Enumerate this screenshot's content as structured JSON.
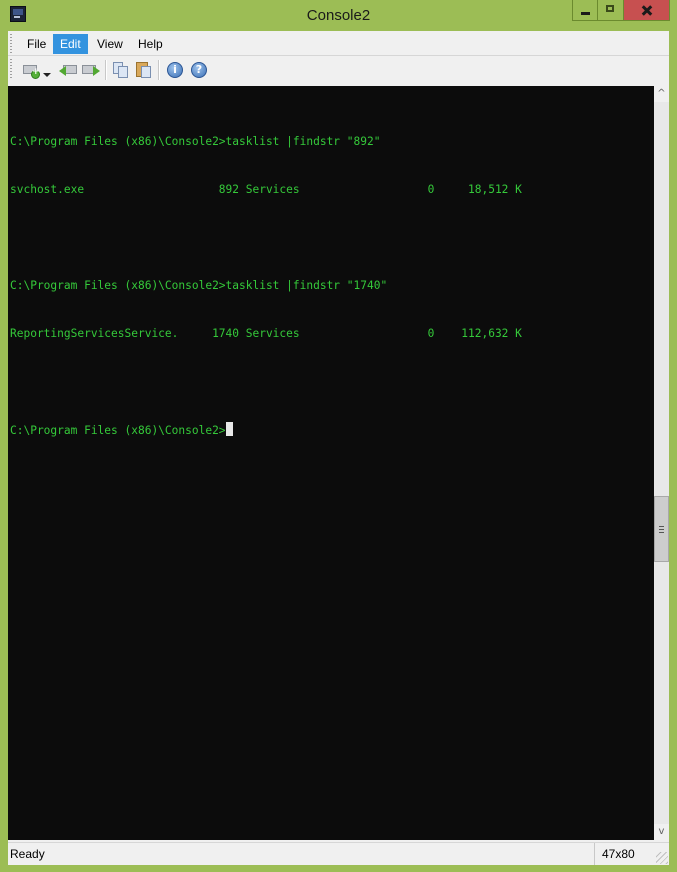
{
  "window": {
    "title": "Console2",
    "icon": "console-app-icon",
    "controls": [
      "minimize",
      "maximize",
      "close"
    ]
  },
  "menu": {
    "items": [
      {
        "label": "File",
        "active": false
      },
      {
        "label": "Edit",
        "active": true
      },
      {
        "label": "View",
        "active": false
      },
      {
        "label": "Help",
        "active": false
      }
    ]
  },
  "toolbar": {
    "buttons": [
      {
        "name": "new-tab",
        "icon": "new-console-icon"
      },
      {
        "name": "new-tab-dropdown",
        "icon": "dropdown-arrow-icon"
      },
      {
        "name": "previous-tab",
        "icon": "arrow-left-icon"
      },
      {
        "name": "next-tab",
        "icon": "arrow-right-icon"
      },
      {
        "name": "copy",
        "icon": "copy-icon"
      },
      {
        "name": "paste",
        "icon": "paste-icon"
      },
      {
        "name": "about",
        "icon": "info-icon",
        "glyph": "i"
      },
      {
        "name": "help",
        "icon": "help-icon",
        "glyph": "?"
      }
    ]
  },
  "console": {
    "lines": [
      "C:\\Program Files (x86)\\Console2>tasklist |findstr \"892\"",
      "svchost.exe                    892 Services                   0     18,512 K",
      "",
      "C:\\Program Files (x86)\\Console2>tasklist |findstr \"1740\"",
      "ReportingServicesService.     1740 Services                   0    112,632 K",
      "",
      "C:\\Program Files (x86)\\Console2>"
    ],
    "text_color": "#35c93a",
    "background": "#0c0c0c"
  },
  "scrollbar": {
    "up_glyph": "^",
    "down_glyph": "v"
  },
  "status": {
    "text": "Ready",
    "size": "47x80"
  }
}
